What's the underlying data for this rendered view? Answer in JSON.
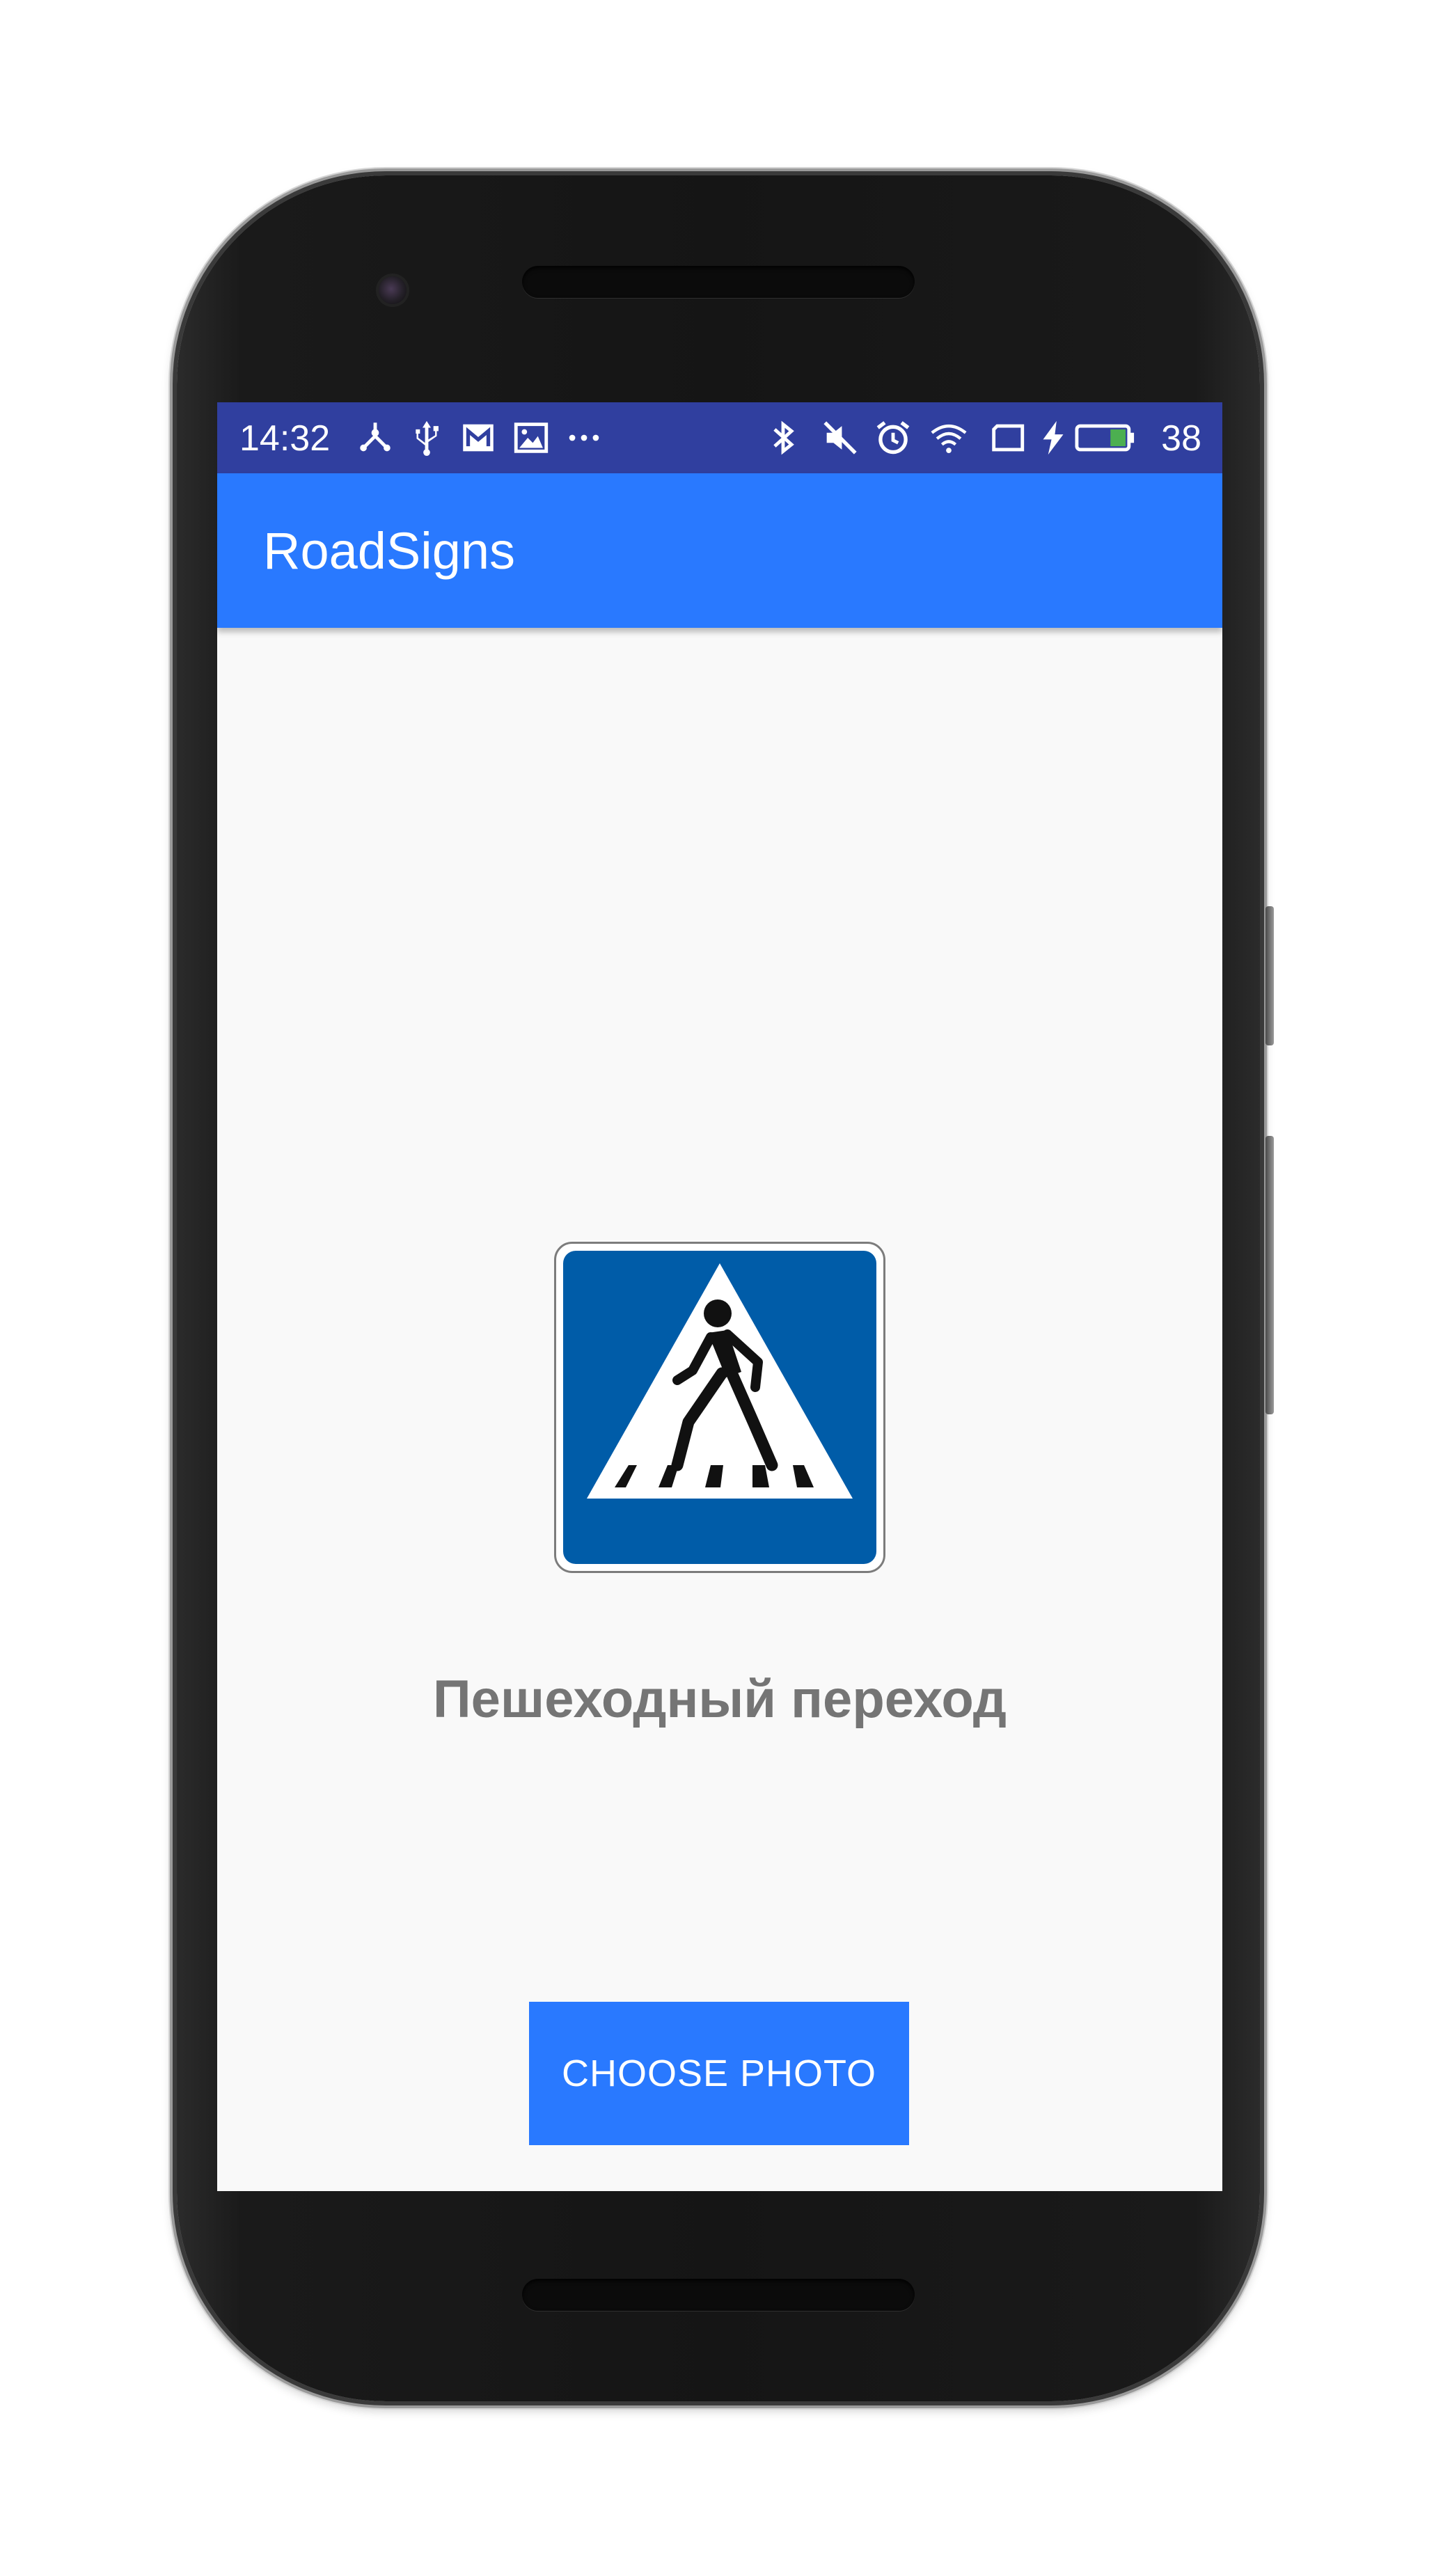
{
  "status_bar": {
    "time": "14:32",
    "battery_percent": "38",
    "left_icons": [
      "network-share-icon",
      "usb-icon",
      "gmail-icon",
      "image-icon",
      "more-notifications-icon"
    ],
    "right_icons": [
      "bluetooth-icon",
      "mute-icon",
      "alarm-icon",
      "wifi-icon",
      "screen-cast-icon",
      "charging-icon",
      "battery-icon"
    ],
    "colors": {
      "background": "#303f9f",
      "battery_fill": "#4caf50"
    }
  },
  "app_bar": {
    "title": "RoadSigns",
    "color": "#2979ff"
  },
  "result": {
    "sign_icon": "pedestrian-crossing-sign",
    "sign_colors": {
      "blue": "#005ca8",
      "white": "#ffffff",
      "figure": "#111111"
    },
    "caption": "Пешеходный переход"
  },
  "actions": {
    "choose_photo_label": "CHOOSE PHOTO"
  }
}
